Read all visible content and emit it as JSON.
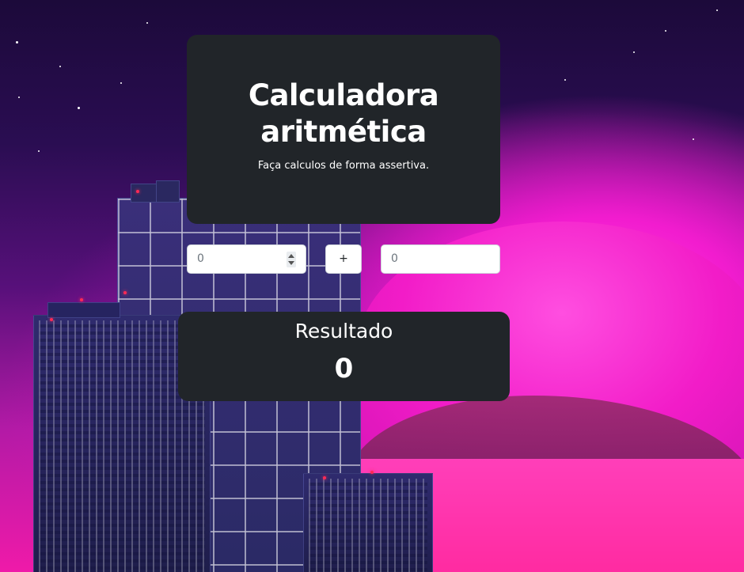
{
  "header": {
    "title": "Calculadora aritmética",
    "subtitle": "Faça calculos de forma assertiva."
  },
  "calculator": {
    "operand1": {
      "value": "0"
    },
    "operator": {
      "label": "+"
    },
    "operand2": {
      "value": "0"
    }
  },
  "result": {
    "label": "Resultado",
    "value": "0"
  },
  "colors": {
    "card_background": "#212529",
    "card_text": "#ffffff",
    "input_background": "#ffffff",
    "input_border": "#ced4da"
  }
}
